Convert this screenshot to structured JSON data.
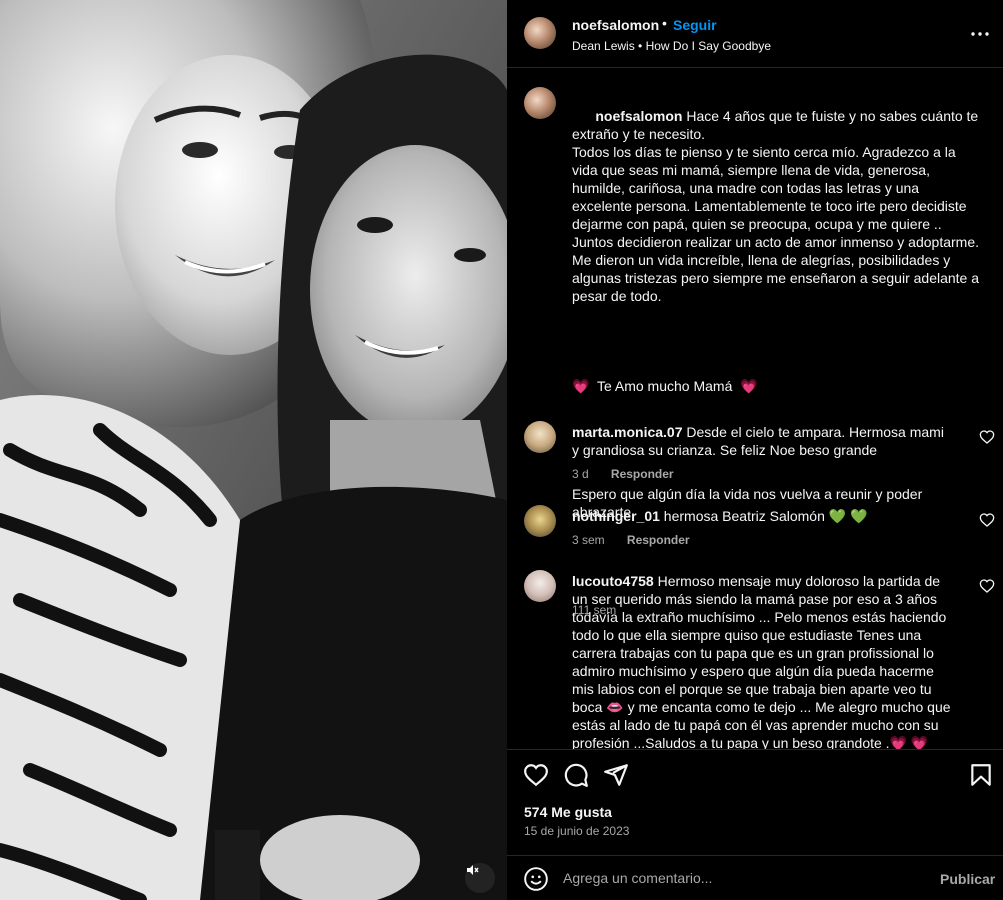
{
  "post": {
    "username": "noefsalomon",
    "follow_label": "Seguir",
    "separator": "•",
    "audio_artist": "Dean Lewis",
    "audio_title": "How Do I Say Goodbye",
    "more_icon": "more-horizontal-icon",
    "caption": {
      "username": "noefsalomon",
      "p1": " Hace 4 años que te fuiste y no sabes cuánto te extraño y te necesito.\nTodos los días te pienso y te siento cerca mío. Agradezco a la vida que seas mi mamá, siempre llena de vida, generosa, humilde, cariñosa, una madre con todas las letras y una excelente persona. Lamentablemente te toco irte pero decidiste dejarme con papá, quien se preocupa, ocupa y me quiere .. Juntos decidieron realizar un acto de amor inmenso y adoptarme. Me dieron un vida increíble, llena de alegrías, posibilidades y algunas tristezas pero siempre me enseñaron a seguir adelante a pesar de todo.",
      "love_line": "Te Amo mucho Mamá",
      "p3": "Espero que algún día la vida nos vuelva a reunir y poder abrazarte.",
      "time": "111 sem",
      "heart_emoji": "💗"
    },
    "comments": [
      {
        "username": "marta.monica.07",
        "text": " Desde el cielo te ampara. Hermosa mami y grandiosa su crianza. Se feliz Noe beso grande",
        "time": "3 d",
        "reply_label": "Responder"
      },
      {
        "username": "nothinger_01",
        "text": " hermosa Beatriz Salomón ",
        "emoji": "💚 💚",
        "time": "3 sem",
        "reply_label": "Responder"
      },
      {
        "username": "lucouto4758",
        "text_a": " Hermoso mensaje muy doloroso la partida de un ser querido más siendo la mamá pase por eso a 3 años todavía la extraño muchísimo ... Pelo menos estás haciendo todo lo que ella siempre quiso que estudiaste Tenes una carrera trabajas con tu papa que es un gran profissional lo admiro muchísimo y espero que algún día pueda hacerme mis labios con el porque se que trabaja bien aparte veo tu boca ",
        "lips_emoji": "👄",
        "text_b": " y me encanta como te dejo ... Me alegro mucho que estás al lado de tu papá con él vas aprender mucho con su profesión ...Saludos a tu papa y un beso grandote .",
        "end_emoji": "💗 💗"
      }
    ],
    "likes": "574 Me gusta",
    "date": "15 de junio de 2023",
    "comment_placeholder": "Agrega un comentario...",
    "publish_label": "Publicar",
    "icons": {
      "like": "heart-icon",
      "comment": "comment-icon",
      "share": "send-icon",
      "save": "bookmark-icon",
      "emoji": "emoji-icon",
      "mute": "mute-icon"
    },
    "colors": {
      "accent": "#0095f6",
      "background": "#000000",
      "secondary_text": "#a8a8a8"
    }
  }
}
